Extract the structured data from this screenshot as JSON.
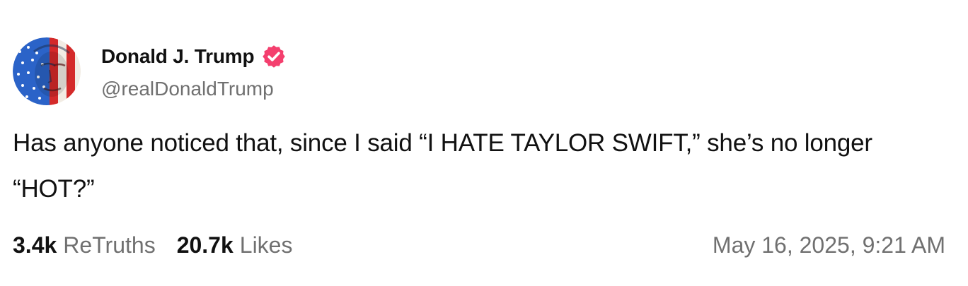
{
  "author": {
    "display_name": "Donald J. Trump",
    "handle": "@realDonaldTrump",
    "avatar_icon": "flag-portrait-avatar",
    "verified_icon": "verified-badge-icon",
    "verified_color": "#f43f6e"
  },
  "post": {
    "text": "Has anyone noticed that, since I said “I HATE TAYLOR SWIFT,” she’s no longer “HOT?”"
  },
  "stats": {
    "retruths_count": "3.4k",
    "retruths_label": "ReTruths",
    "likes_count": "20.7k",
    "likes_label": "Likes"
  },
  "timestamp": "May 16, 2025, 9:21 AM",
  "colors": {
    "text_primary": "#111111",
    "text_secondary": "#707070",
    "background": "#ffffff"
  }
}
